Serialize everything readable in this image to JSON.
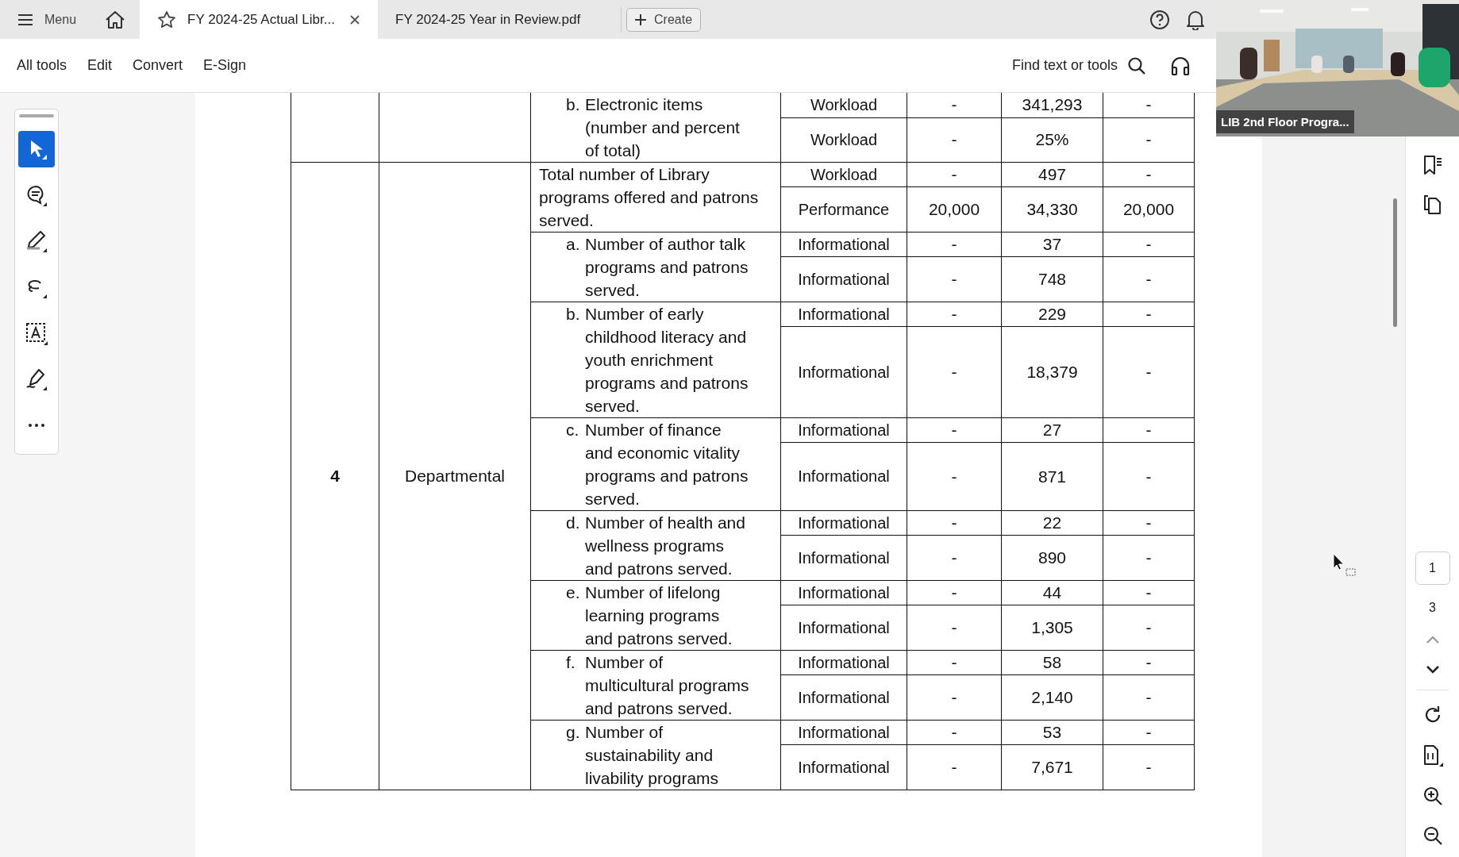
{
  "menu": {
    "label": "Menu"
  },
  "tabs": [
    {
      "label": "FY 2024-25 Actual Libr...",
      "selected": true
    },
    {
      "label": "FY 2024-25 Year in Review.pdf",
      "selected": false
    }
  ],
  "create_button": "Create",
  "toolbar": [
    "All tools",
    "Edit",
    "Convert",
    "E-Sign"
  ],
  "search": {
    "label": "Find text or tools"
  },
  "video": {
    "label": "LIB 2nd Floor Progra..."
  },
  "tools": [
    {
      "kind": "select",
      "selected": true
    },
    {
      "kind": "comment",
      "selected": false
    },
    {
      "kind": "highlight",
      "selected": false
    },
    {
      "kind": "lasso",
      "selected": false
    },
    {
      "kind": "text",
      "selected": false
    },
    {
      "kind": "sign",
      "selected": false
    },
    {
      "kind": "more",
      "selected": false
    }
  ],
  "page_nav": {
    "current": "1",
    "total": "3"
  },
  "table": {
    "sections": [
      {
        "items": [
          {
            "letter": "b.",
            "description": "Electronic items (number and percent of total)",
            "rows": [
              {
                "type": "Workload",
                "column_4": "-",
                "column_5": "341,293",
                "column_6": "-"
              },
              {
                "type": "Workload",
                "column_4": "-",
                "column_5": "25%",
                "column_6": "-"
              }
            ]
          }
        ]
      },
      {
        "number": "4",
        "category": "Departmental",
        "items": [
          {
            "description": "Total number of Library programs offered and patrons served.",
            "rows": [
              {
                "type": "Workload",
                "column_4": "-",
                "column_5": "497",
                "column_6": "-"
              },
              {
                "type": "Performance",
                "column_4": "20,000",
                "column_5": "34,330",
                "column_6": "20,000"
              }
            ]
          },
          {
            "letter": "a.",
            "description": "Number of author talk programs and patrons served.",
            "rows": [
              {
                "type": "Informational",
                "column_4": "-",
                "column_5": "37",
                "column_6": "-"
              },
              {
                "type": "Informational",
                "column_4": "-",
                "column_5": "748",
                "column_6": "-"
              }
            ]
          },
          {
            "letter": "b.",
            "description": "Number of early childhood literacy and youth enrichment programs and patrons served.",
            "rows": [
              {
                "type": "Informational",
                "column_4": "-",
                "column_5": "229",
                "column_6": "-"
              },
              {
                "type": "Informational",
                "column_4": "-",
                "column_5": "18,379",
                "column_6": "-"
              }
            ]
          },
          {
            "letter": "c.",
            "description": "Number of finance and economic vitality programs and patrons served.",
            "rows": [
              {
                "type": "Informational",
                "column_4": "-",
                "column_5": "27",
                "column_6": "-"
              },
              {
                "type": "Informational",
                "column_4": "-",
                "column_5": "871",
                "column_6": "-"
              }
            ]
          },
          {
            "letter": "d.",
            "description": "Number of health and wellness programs and patrons served.",
            "rows": [
              {
                "type": "Informational",
                "column_4": "-",
                "column_5": "22",
                "column_6": "-"
              },
              {
                "type": "Informational",
                "column_4": "-",
                "column_5": "890",
                "column_6": "-"
              }
            ]
          },
          {
            "letter": "e.",
            "description": "Number of lifelong learning programs and patrons served.",
            "rows": [
              {
                "type": "Informational",
                "column_4": "-",
                "column_5": "44",
                "column_6": "-"
              },
              {
                "type": "Informational",
                "column_4": "-",
                "column_5": "1,305",
                "column_6": "-"
              }
            ]
          },
          {
            "letter": "f.",
            "description": "Number of multicultural programs and patrons served.",
            "rows": [
              {
                "type": "Informational",
                "column_4": "-",
                "column_5": "58",
                "column_6": "-"
              },
              {
                "type": "Informational",
                "column_4": "-",
                "column_5": "2,140",
                "column_6": "-"
              }
            ]
          },
          {
            "letter": "g.",
            "description": "Number of sustainability and livability programs",
            "rows": [
              {
                "type": "Informational",
                "column_4": "-",
                "column_5": "53",
                "column_6": "-"
              },
              {
                "type": "Informational",
                "column_4": "-",
                "column_5": "7,671",
                "column_6": "-"
              }
            ]
          }
        ]
      }
    ]
  }
}
